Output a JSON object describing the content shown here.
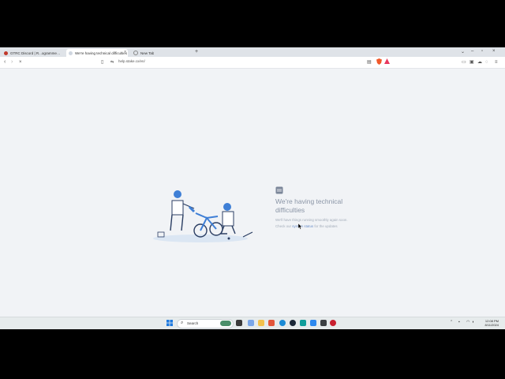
{
  "browser": {
    "tabs": [
      {
        "label": "GTRC Discord | R...ogrammed | Coursera",
        "active": false
      },
      {
        "label": "We're having technical difficulties",
        "active": true
      },
      {
        "label": "New Tab",
        "active": false
      }
    ],
    "new_tab_glyph": "+",
    "url": "help.stake.cx/en/"
  },
  "page": {
    "heading": "We're having technical difficulties",
    "subtext": "We'll have things running smoothly again soon.",
    "status_prefix": "Check our",
    "status_link": "system status",
    "status_suffix": "for the updates",
    "accent": "#3f7fd6",
    "link_color": "#6b8fc9"
  },
  "taskbar": {
    "search_label": "Search",
    "clock_time": "12:08 PM",
    "clock_date": "8/11/2024"
  },
  "icons": [
    "back-icon",
    "forward-icon",
    "stop-icon",
    "bookmark-icon",
    "site-info-icon",
    "reader-icon",
    "brave-shield-icon",
    "rewards-icon",
    "sidebar-icon",
    "wallet-icon",
    "vpn-icon",
    "menu-icon",
    "windows-start-icon",
    "search-icon"
  ]
}
